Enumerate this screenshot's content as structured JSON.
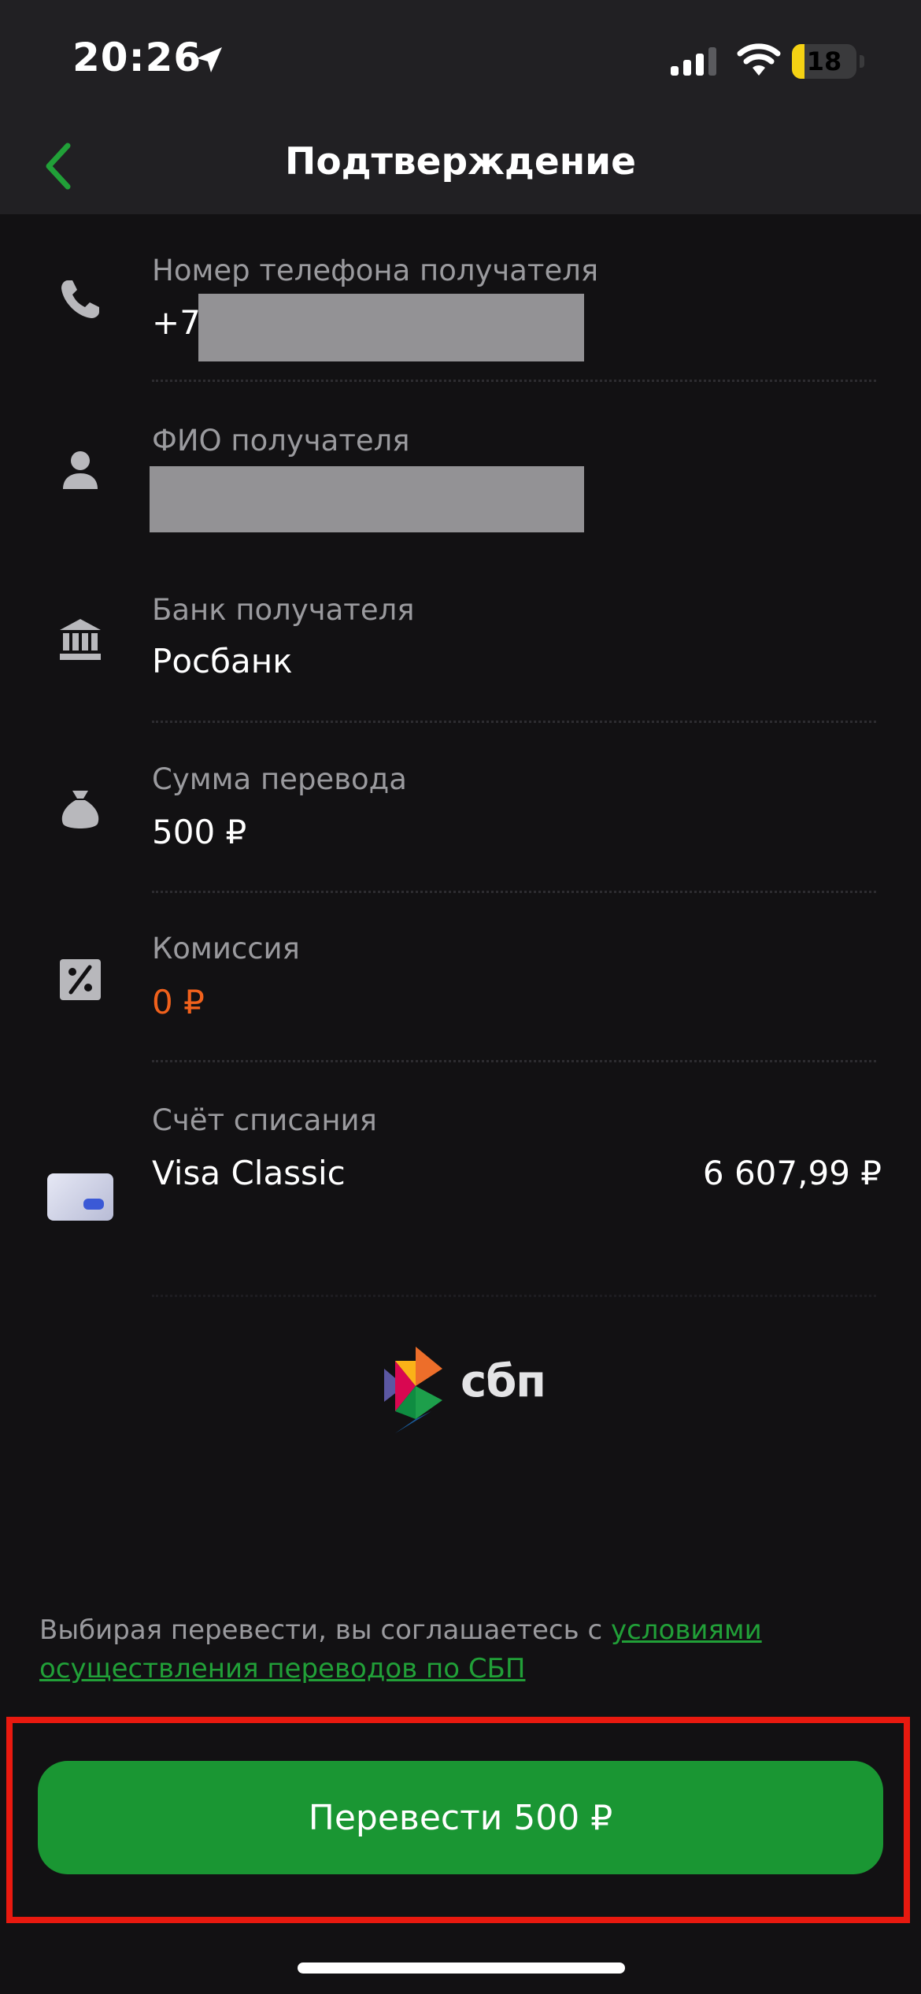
{
  "status_bar": {
    "time": "20:26",
    "battery": "18"
  },
  "header": {
    "title": "Подтверждение"
  },
  "rows": {
    "phone": {
      "label": "Номер телефона получателя",
      "value": "+7"
    },
    "name": {
      "label": "ФИО получателя"
    },
    "bank": {
      "label": "Банк получателя",
      "value": "Росбанк"
    },
    "amount": {
      "label": "Сумма перевода",
      "value": "500 ₽"
    },
    "commission": {
      "label": "Комиссия",
      "value": "0 ₽"
    },
    "account": {
      "label": "Счёт списания",
      "value": "Visa Classic",
      "balance": "6 607,99 ₽"
    }
  },
  "sbp": {
    "logo_text": "сбп"
  },
  "terms": {
    "text": "Выбирая перевести, вы соглашаетесь с ",
    "link": "условиями осуществления переводов по СБП"
  },
  "cta": {
    "label": "Перевести 500 ₽"
  },
  "colors": {
    "accent": "#21a038",
    "button": "#1a9633",
    "commission": "#f0611c",
    "highlight": "#e8190f"
  },
  "icons": [
    "location-arrow-icon",
    "signal-icon",
    "wifi-icon",
    "battery-icon",
    "back-chevron-icon",
    "phone-icon",
    "person-icon",
    "bank-icon",
    "money-bag-icon",
    "percent-icon",
    "card-icon",
    "sbp-logo-icon"
  ]
}
